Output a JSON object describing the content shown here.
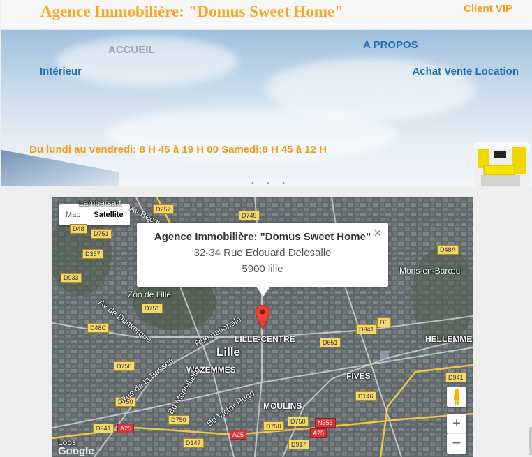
{
  "header": {
    "site_title": "Agence Immobilière: \"Domus Sweet Home\"",
    "vip_link": "Client VIP"
  },
  "nav": {
    "home": "ACCUEIL",
    "about": "A PROPOS",
    "interior": "Intérieur",
    "buy_sell_rent": "Achat Vente Location"
  },
  "hours": "Du lundi au vendredi: 8 H 45 à 19 H 00 Samedi:8 H 45 à 12 H",
  "map": {
    "type_buttons": {
      "map": "Map",
      "satellite": "Satellite",
      "selected": "Satellite"
    },
    "info_window": {
      "name": "Agence Immobilière: \"Domus Sweet Home\"",
      "address": "32-34 Rue Edouard Delesalle",
      "city": "5900 lille",
      "close": "×"
    },
    "labels": {
      "lille": "Lille",
      "lille_centre": "LILLE-CENTRE",
      "wazemmes": "WAZEMMES",
      "moulins": "MOULINS",
      "fives": "FIVES",
      "hellemmes": "HELLEMMES",
      "mons": "Mons-en-Barœul",
      "zoo": "Zoo de Lille",
      "loos": "Loos",
      "lambersart": "Lambersart",
      "av_becquart": "Av Becquart",
      "av_dunkerque": "Av de Dunkerque",
      "rue_nationale": "Rue nationale",
      "rue_bassee": "Rue de la Bassée",
      "bd_montebello": "Bd Montebello",
      "bd_victor_hugo": "Bd Victor Hugo"
    },
    "roads": {
      "d257": "D257",
      "d749": "D749",
      "d48": "D48",
      "d751a": "D751",
      "d357": "D357",
      "d933": "D933",
      "d751b": "D751",
      "d48c": "D48C",
      "d750a": "D750",
      "d750b": "D750",
      "d941a": "D941",
      "a25a": "A25",
      "d750c": "D750",
      "d147": "D147",
      "a25b": "A25",
      "d750d": "D750",
      "d750e": "D750",
      "n356": "N356",
      "a25c": "A25",
      "d917": "D917",
      "d651": "D651",
      "d941b": "D941",
      "d6": "D6",
      "d48a": "D48A",
      "d146": "D146",
      "d941c": "D941"
    },
    "zoom_in": "+",
    "zoom_out": "−",
    "google": "Google"
  },
  "colors": {
    "title_orange": "#f7a823",
    "link_blue": "#1f6fb5",
    "muted_gray": "#9aa3ad"
  }
}
